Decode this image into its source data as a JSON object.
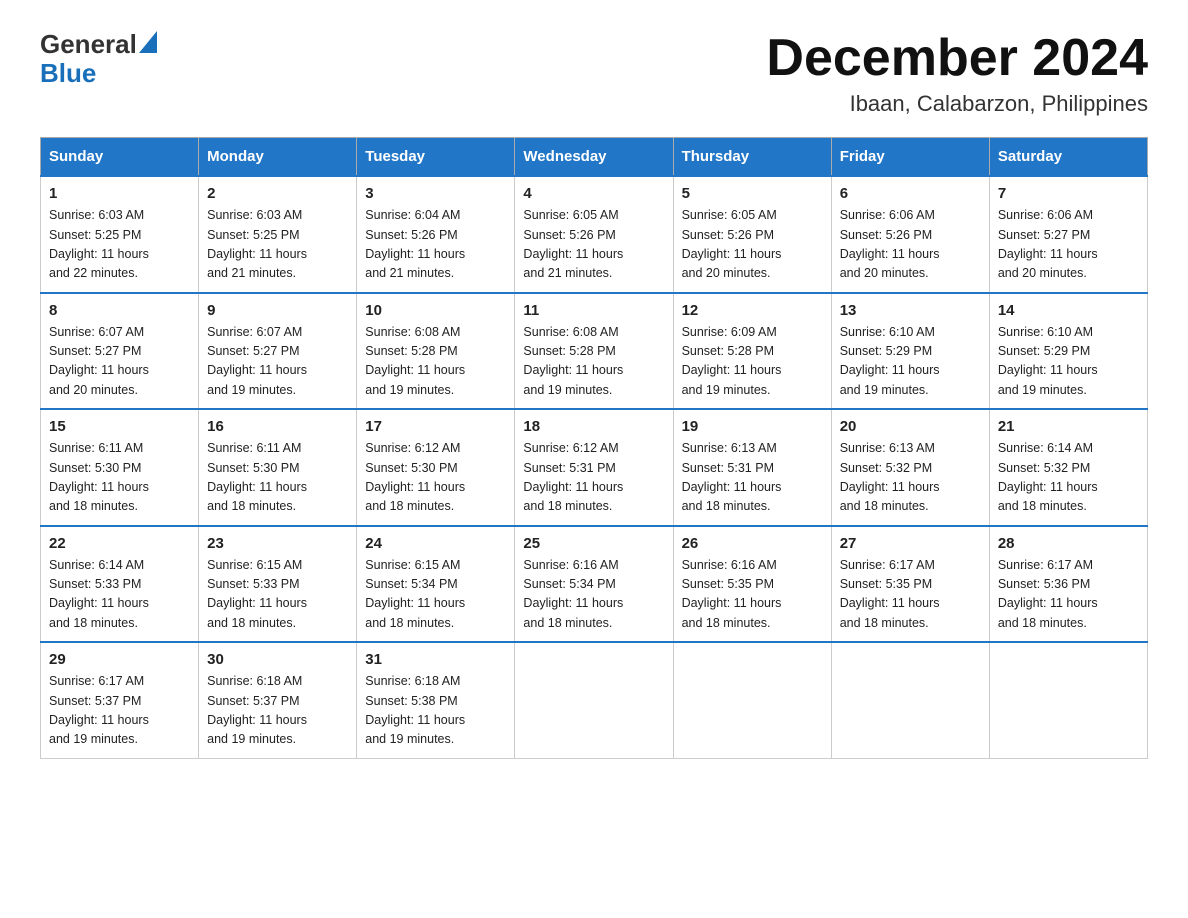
{
  "header": {
    "logo_general": "General",
    "logo_blue": "Blue",
    "title": "December 2024",
    "subtitle": "Ibaan, Calabarzon, Philippines"
  },
  "days_of_week": [
    "Sunday",
    "Monday",
    "Tuesday",
    "Wednesday",
    "Thursday",
    "Friday",
    "Saturday"
  ],
  "weeks": [
    [
      {
        "day": "1",
        "sunrise": "6:03 AM",
        "sunset": "5:25 PM",
        "daylight": "11 hours and 22 minutes."
      },
      {
        "day": "2",
        "sunrise": "6:03 AM",
        "sunset": "5:25 PM",
        "daylight": "11 hours and 21 minutes."
      },
      {
        "day": "3",
        "sunrise": "6:04 AM",
        "sunset": "5:26 PM",
        "daylight": "11 hours and 21 minutes."
      },
      {
        "day": "4",
        "sunrise": "6:05 AM",
        "sunset": "5:26 PM",
        "daylight": "11 hours and 21 minutes."
      },
      {
        "day": "5",
        "sunrise": "6:05 AM",
        "sunset": "5:26 PM",
        "daylight": "11 hours and 20 minutes."
      },
      {
        "day": "6",
        "sunrise": "6:06 AM",
        "sunset": "5:26 PM",
        "daylight": "11 hours and 20 minutes."
      },
      {
        "day": "7",
        "sunrise": "6:06 AM",
        "sunset": "5:27 PM",
        "daylight": "11 hours and 20 minutes."
      }
    ],
    [
      {
        "day": "8",
        "sunrise": "6:07 AM",
        "sunset": "5:27 PM",
        "daylight": "11 hours and 20 minutes."
      },
      {
        "day": "9",
        "sunrise": "6:07 AM",
        "sunset": "5:27 PM",
        "daylight": "11 hours and 19 minutes."
      },
      {
        "day": "10",
        "sunrise": "6:08 AM",
        "sunset": "5:28 PM",
        "daylight": "11 hours and 19 minutes."
      },
      {
        "day": "11",
        "sunrise": "6:08 AM",
        "sunset": "5:28 PM",
        "daylight": "11 hours and 19 minutes."
      },
      {
        "day": "12",
        "sunrise": "6:09 AM",
        "sunset": "5:28 PM",
        "daylight": "11 hours and 19 minutes."
      },
      {
        "day": "13",
        "sunrise": "6:10 AM",
        "sunset": "5:29 PM",
        "daylight": "11 hours and 19 minutes."
      },
      {
        "day": "14",
        "sunrise": "6:10 AM",
        "sunset": "5:29 PM",
        "daylight": "11 hours and 19 minutes."
      }
    ],
    [
      {
        "day": "15",
        "sunrise": "6:11 AM",
        "sunset": "5:30 PM",
        "daylight": "11 hours and 18 minutes."
      },
      {
        "day": "16",
        "sunrise": "6:11 AM",
        "sunset": "5:30 PM",
        "daylight": "11 hours and 18 minutes."
      },
      {
        "day": "17",
        "sunrise": "6:12 AM",
        "sunset": "5:30 PM",
        "daylight": "11 hours and 18 minutes."
      },
      {
        "day": "18",
        "sunrise": "6:12 AM",
        "sunset": "5:31 PM",
        "daylight": "11 hours and 18 minutes."
      },
      {
        "day": "19",
        "sunrise": "6:13 AM",
        "sunset": "5:31 PM",
        "daylight": "11 hours and 18 minutes."
      },
      {
        "day": "20",
        "sunrise": "6:13 AM",
        "sunset": "5:32 PM",
        "daylight": "11 hours and 18 minutes."
      },
      {
        "day": "21",
        "sunrise": "6:14 AM",
        "sunset": "5:32 PM",
        "daylight": "11 hours and 18 minutes."
      }
    ],
    [
      {
        "day": "22",
        "sunrise": "6:14 AM",
        "sunset": "5:33 PM",
        "daylight": "11 hours and 18 minutes."
      },
      {
        "day": "23",
        "sunrise": "6:15 AM",
        "sunset": "5:33 PM",
        "daylight": "11 hours and 18 minutes."
      },
      {
        "day": "24",
        "sunrise": "6:15 AM",
        "sunset": "5:34 PM",
        "daylight": "11 hours and 18 minutes."
      },
      {
        "day": "25",
        "sunrise": "6:16 AM",
        "sunset": "5:34 PM",
        "daylight": "11 hours and 18 minutes."
      },
      {
        "day": "26",
        "sunrise": "6:16 AM",
        "sunset": "5:35 PM",
        "daylight": "11 hours and 18 minutes."
      },
      {
        "day": "27",
        "sunrise": "6:17 AM",
        "sunset": "5:35 PM",
        "daylight": "11 hours and 18 minutes."
      },
      {
        "day": "28",
        "sunrise": "6:17 AM",
        "sunset": "5:36 PM",
        "daylight": "11 hours and 18 minutes."
      }
    ],
    [
      {
        "day": "29",
        "sunrise": "6:17 AM",
        "sunset": "5:37 PM",
        "daylight": "11 hours and 19 minutes."
      },
      {
        "day": "30",
        "sunrise": "6:18 AM",
        "sunset": "5:37 PM",
        "daylight": "11 hours and 19 minutes."
      },
      {
        "day": "31",
        "sunrise": "6:18 AM",
        "sunset": "5:38 PM",
        "daylight": "11 hours and 19 minutes."
      },
      null,
      null,
      null,
      null
    ]
  ],
  "labels": {
    "sunrise": "Sunrise:",
    "sunset": "Sunset:",
    "daylight": "Daylight:"
  }
}
